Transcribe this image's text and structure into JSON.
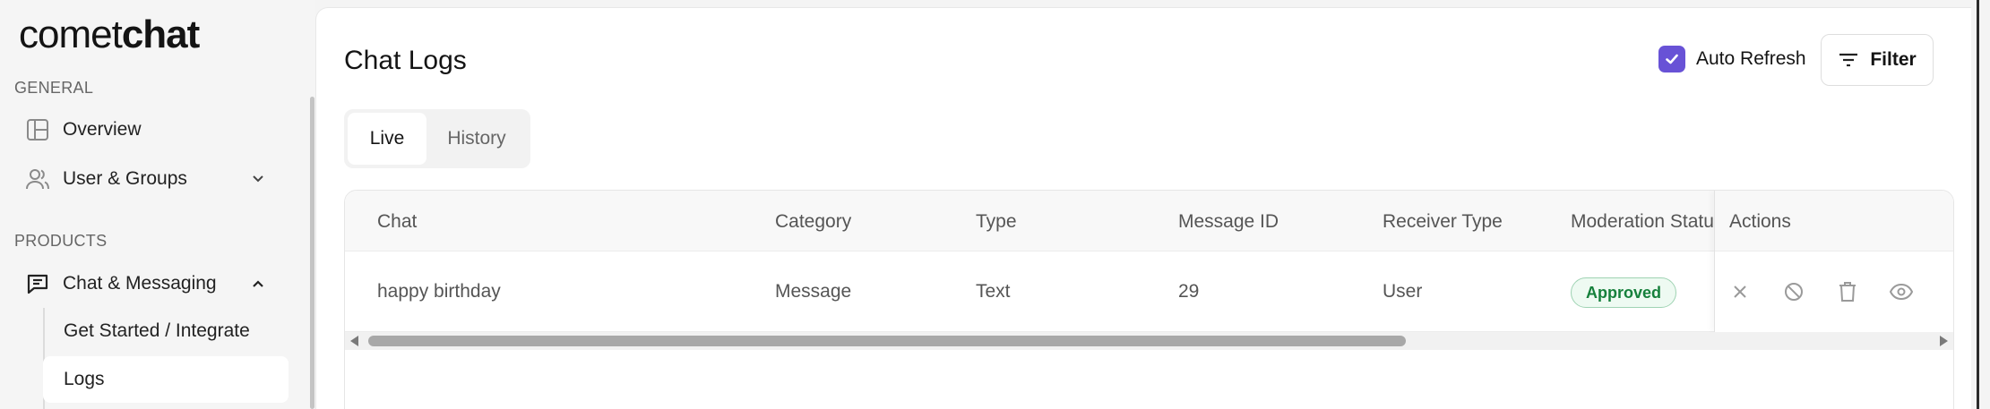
{
  "logo": {
    "light": "comet",
    "bold": "chat"
  },
  "sidebar": {
    "general_label": "GENERAL",
    "overview": "Overview",
    "users_groups": "User & Groups",
    "products_label": "PRODUCTS",
    "chat_messaging": "Chat & Messaging",
    "get_started": "Get Started / Integrate",
    "logs": "Logs"
  },
  "page": {
    "title": "Chat Logs",
    "auto_refresh_label": "Auto Refresh",
    "auto_refresh_checked": true,
    "filter_label": "Filter"
  },
  "tabs": [
    {
      "label": "Live",
      "active": true
    },
    {
      "label": "History",
      "active": false
    }
  ],
  "table": {
    "columns": [
      "Chat",
      "Category",
      "Type",
      "Message ID",
      "Receiver Type",
      "Moderation Status",
      "Actions"
    ],
    "rows": [
      {
        "chat": "happy birthday",
        "category": "Message",
        "type": "Text",
        "message_id": "29",
        "receiver_type": "User",
        "moderation_status": "Approved"
      }
    ],
    "action_icons": [
      "close-icon",
      "block-icon",
      "trash-icon",
      "eye-icon"
    ]
  },
  "colors": {
    "accent": "#6852d6",
    "approved_text": "#16803c",
    "approved_bg": "#eefaf2"
  }
}
